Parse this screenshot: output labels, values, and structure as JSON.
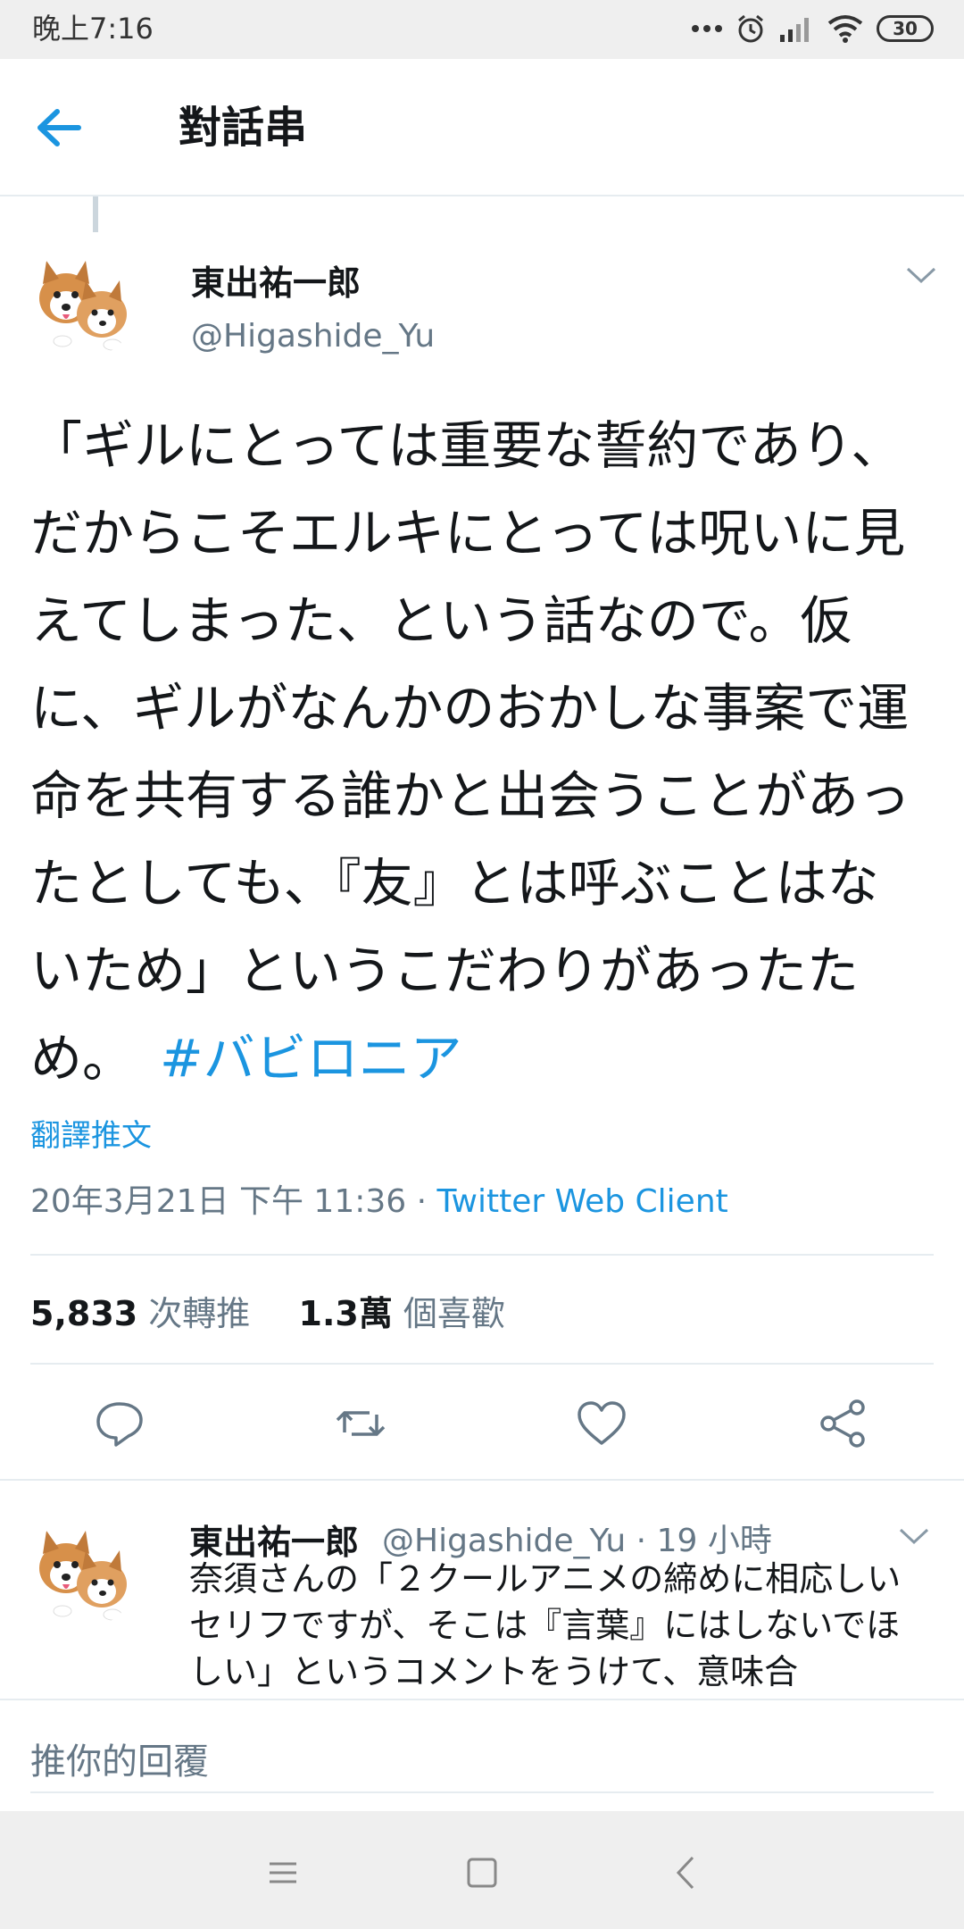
{
  "status_bar": {
    "time": "晚上7:16",
    "battery": "30",
    "icons": [
      "more-icon",
      "alarm-icon",
      "signal-icon",
      "wifi-icon",
      "battery-icon"
    ]
  },
  "app_bar": {
    "title": "對話串",
    "back_icon": "back-arrow-icon"
  },
  "tweet": {
    "author_name": "東出祐一郎",
    "author_handle": "@Higashide_Yu",
    "body": "「ギルにとっては重要な誓約であり、だからこそエルキにとっては呪いに見えてしまった、という話なので。仮に、ギルがなんかのおかしな事案で運命を共有する誰かと出会うことがあったとしても、『友』とは呼ぶことはないため」というこだわりがあったため。　",
    "hashtag": "#バビロニア",
    "translate_label": "翻譯推文",
    "timestamp": "20年3月21日 下午 11:36 · ",
    "client": "Twitter Web Client",
    "retweet_count": "5,833",
    "retweet_label": "次轉推",
    "like_count": "1.3萬",
    "like_label": "個喜歡",
    "actions": [
      "reply-icon",
      "retweet-icon",
      "like-icon",
      "share-icon"
    ]
  },
  "reply": {
    "author_name": "東出祐一郎",
    "author_handle": "@Higashide_Yu · 19 小時",
    "body": "奈須さんの「２クールアニメの締めに相応しいセリフですが、そこは『言葉』にはしないでほしい」というコメントをうけて、意味合"
  },
  "compose": {
    "placeholder": "推你的回覆"
  },
  "nav_bar": [
    "menu-icon",
    "home-icon",
    "back-icon"
  ],
  "colors": {
    "accent": "#1b95e0",
    "text": "#14171a",
    "secondary": "#657786",
    "divider": "#e6ecf0"
  }
}
